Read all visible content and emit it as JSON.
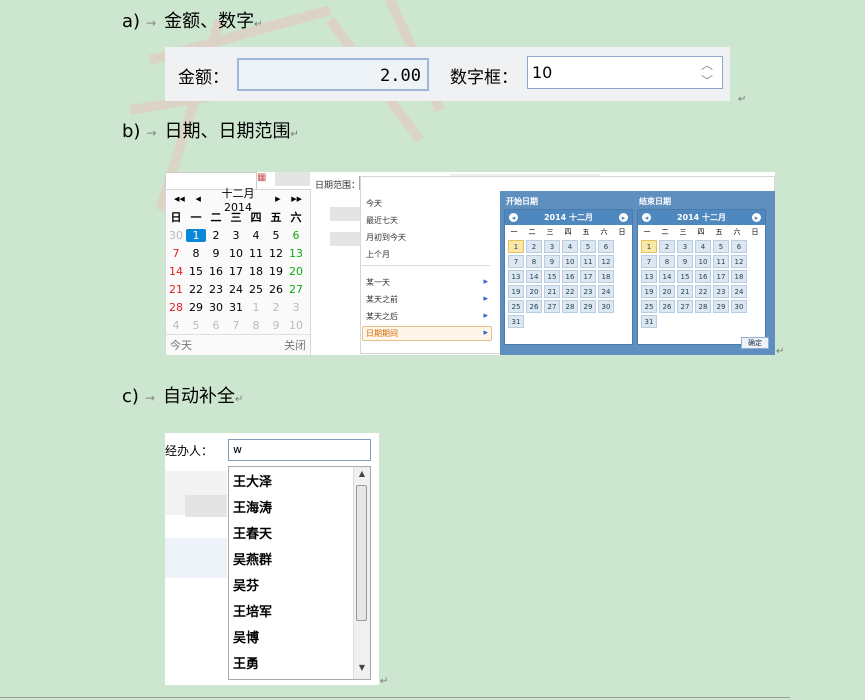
{
  "sections": {
    "a": {
      "marker": "a)",
      "title": "金额、数字"
    },
    "b": {
      "marker": "b)",
      "title": "日期、日期范围"
    },
    "c": {
      "marker": "c)",
      "title": "自动补全"
    }
  },
  "paragraph_mark": "↵",
  "money": {
    "label": "金额：",
    "value": "2.00"
  },
  "number": {
    "label": "数字框：",
    "value": "10"
  },
  "datepicker": {
    "nav_prev_year": "◀◀",
    "nav_prev_month": "◀",
    "title": "十二月 2014",
    "nav_next_month": "▶",
    "nav_next_year": "▶▶",
    "weekdays": [
      "日",
      "一",
      "二",
      "三",
      "四",
      "五",
      "六"
    ],
    "weeks": [
      [
        "30",
        "1",
        "2",
        "3",
        "4",
        "5",
        "6"
      ],
      [
        "7",
        "8",
        "9",
        "10",
        "11",
        "12",
        "13"
      ],
      [
        "14",
        "15",
        "16",
        "17",
        "18",
        "19",
        "20"
      ],
      [
        "21",
        "22",
        "23",
        "24",
        "25",
        "26",
        "27"
      ],
      [
        "28",
        "29",
        "30",
        "31",
        "1",
        "2",
        "3"
      ],
      [
        "4",
        "5",
        "6",
        "7",
        "8",
        "9",
        "10"
      ]
    ],
    "today_label": "今天",
    "close_label": "关闭"
  },
  "range": {
    "label": "日期范围：",
    "quick": [
      "今天",
      "最近七天",
      "月初到今天",
      "上个月"
    ],
    "quick_more": [
      "某一天",
      "某天之前",
      "某天之后",
      "日期期间"
    ],
    "start_title": "开始日期",
    "end_title": "结束日期",
    "month_title": "2014 十二月",
    "weekdays": [
      "一",
      "二",
      "三",
      "四",
      "五",
      "六",
      "日"
    ],
    "confirm": "确定"
  },
  "autocomplete": {
    "label": "经办人：",
    "value": "w",
    "options": [
      "王大泽",
      "王海涛",
      "王春天",
      "吴燕群",
      "吴芬",
      "王培军",
      "吴博",
      "王勇"
    ]
  }
}
